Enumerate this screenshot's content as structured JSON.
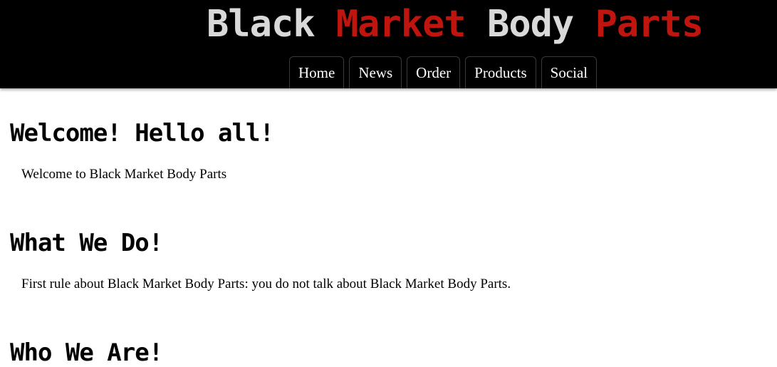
{
  "colors": {
    "header_bg": "#000000",
    "title_light": "#d9d9d9",
    "title_red": "#c0150f",
    "nav_text": "#ffffff",
    "body_bg": "#ffffff",
    "body_text": "#000000"
  },
  "header": {
    "title_parts": [
      "Black",
      "Market",
      "Body",
      "Parts"
    ],
    "nav": [
      "Home",
      "News",
      "Order",
      "Products",
      "Social"
    ]
  },
  "sections": [
    {
      "heading": "Welcome! Hello all!",
      "text": "Welcome to Black Market Body Parts"
    },
    {
      "heading": "What We Do!",
      "text": "First rule about Black Market Body Parts: you do not talk about Black Market Body Parts."
    },
    {
      "heading": "Who We Are!",
      "text": ""
    }
  ]
}
